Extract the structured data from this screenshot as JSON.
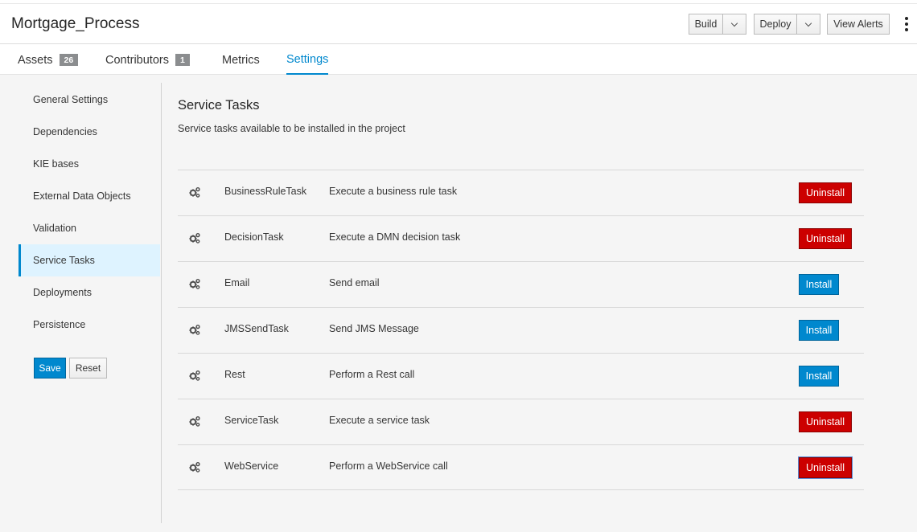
{
  "header": {
    "title": "Mortgage_Process",
    "build_label": "Build",
    "deploy_label": "Deploy",
    "view_alerts_label": "View Alerts"
  },
  "tabs": [
    {
      "label": "Assets",
      "badge": "26"
    },
    {
      "label": "Contributors",
      "badge": "1"
    },
    {
      "label": "Metrics"
    },
    {
      "label": "Settings",
      "active": true
    }
  ],
  "sidebar": {
    "items": [
      {
        "label": "General Settings"
      },
      {
        "label": "Dependencies"
      },
      {
        "label": "KIE bases"
      },
      {
        "label": "External Data Objects"
      },
      {
        "label": "Validation"
      },
      {
        "label": "Service Tasks",
        "active": true
      },
      {
        "label": "Deployments"
      },
      {
        "label": "Persistence"
      }
    ],
    "save_label": "Save",
    "reset_label": "Reset"
  },
  "main": {
    "title": "Service Tasks",
    "description": "Service tasks available to be installed in the project",
    "tasks": [
      {
        "name": "BusinessRuleTask",
        "description": "Execute a business rule task",
        "action": "Uninstall"
      },
      {
        "name": "DecisionTask",
        "description": "Execute a DMN decision task",
        "action": "Uninstall"
      },
      {
        "name": "Email",
        "description": "Send email",
        "action": "Install"
      },
      {
        "name": "JMSSendTask",
        "description": "Send JMS Message",
        "action": "Install"
      },
      {
        "name": "Rest",
        "description": "Perform a Rest call",
        "action": "Install"
      },
      {
        "name": "ServiceTask",
        "description": "Execute a service task",
        "action": "Uninstall"
      },
      {
        "name": "WebService",
        "description": "Perform a WebService call",
        "action": "Uninstall"
      }
    ]
  },
  "colors": {
    "accent": "#0088ce",
    "danger": "#cc0000",
    "active_bg": "#def3ff"
  },
  "icons": {
    "row_icon": "cogs-icon",
    "caret": "chevron-down-icon",
    "menu": "kebab-icon"
  }
}
